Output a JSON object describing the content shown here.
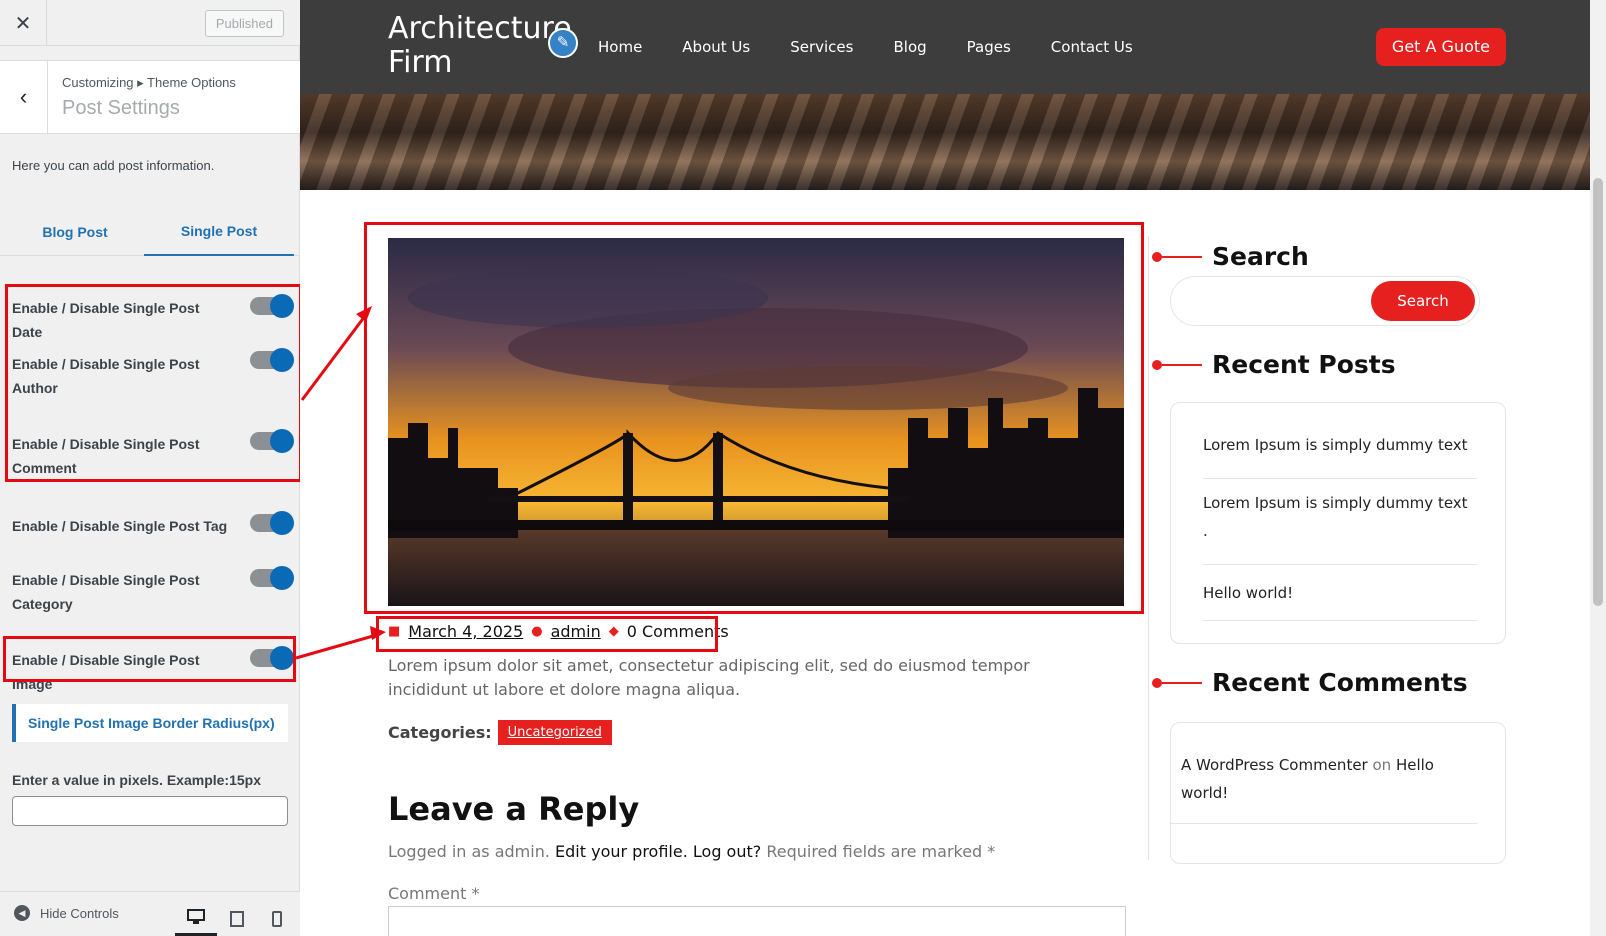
{
  "customizer": {
    "close_icon": "close-icon",
    "published_label": "Published",
    "breadcrumb": "Customizing ▸ Theme Options",
    "section_title": "Post Settings",
    "description": "Here you can add post information.",
    "tabs": [
      {
        "label": "Blog Post",
        "active": false
      },
      {
        "label": "Single Post",
        "active": true
      }
    ],
    "options": [
      {
        "label": "Enable / Disable Single Post Date",
        "enabled": true
      },
      {
        "label": "Enable / Disable Single Post Author",
        "enabled": true
      },
      {
        "label": "Enable / Disable Single Post Comment",
        "enabled": true
      },
      {
        "label": "Enable / Disable Single Post Tag",
        "enabled": true
      },
      {
        "label": "Enable / Disable Single Post Category",
        "enabled": true
      },
      {
        "label": "Enable / Disable Single Post Image",
        "enabled": true
      }
    ],
    "border_radius_label": "Single Post Image Border Radius(px)",
    "pixel_hint": "Enter a value in pixels. Example:15px",
    "pixel_value": "",
    "hide_controls": "Hide Controls",
    "devices": [
      "desktop-icon",
      "tablet-icon",
      "mobile-icon"
    ]
  },
  "site": {
    "logo": "Architecture Firm",
    "nav": [
      "Home",
      "About Us",
      "Services",
      "Blog",
      "Pages",
      "Contact Us"
    ],
    "cta": "Get A Guote",
    "post": {
      "date": "March 4, 2025",
      "author": "admin",
      "comments": "0 Comments",
      "excerpt": "Lorem ipsum dolor sit amet, consectetur adipiscing elit, sed do eiusmod tempor incididunt ut labore et dolore magna aliqua.",
      "categories_label": "Categories:",
      "category": "Uncategorized"
    },
    "reply": {
      "title": "Leave a Reply",
      "logged_prefix": "Logged in as admin.",
      "edit_profile": "Edit your profile.",
      "logout": "Log out?",
      "required": "Required fields are marked *",
      "comment_label": "Comment *"
    },
    "sidebar": {
      "search_title": "Search",
      "search_button": "Search",
      "recent_posts_title": "Recent Posts",
      "recent_posts": [
        "Lorem Ipsum is simply dummy text",
        "Lorem Ipsum is simply dummy text .",
        "Hello world!"
      ],
      "recent_comments_title": "Recent Comments",
      "comment_author": "A WordPress Commenter",
      "comment_on": "on",
      "comment_post": "Hello world!"
    }
  },
  "colors": {
    "accent": "#e61f1f",
    "highlight": "#e50914",
    "wp_blue": "#2271b1",
    "header_bg": "#3d3d3d"
  }
}
